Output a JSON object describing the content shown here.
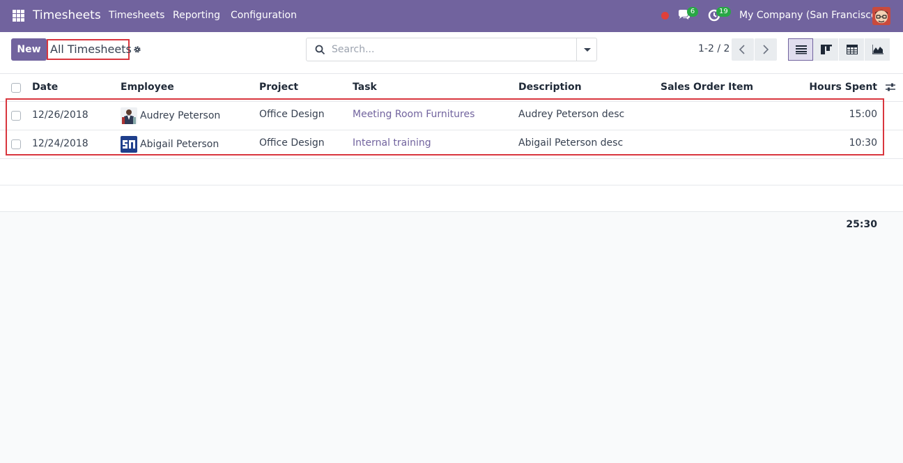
{
  "navbar": {
    "brand": "Timesheets",
    "menu": [
      "Timesheets",
      "Reporting",
      "Configuration"
    ],
    "messages_badge": "6",
    "activities_badge": "19",
    "company": "My Company (San Francisco)"
  },
  "control": {
    "new_label": "New",
    "title": "All Timesheets",
    "search_placeholder": "Search...",
    "pager": "1-2 / 2"
  },
  "table": {
    "headers": {
      "date": "Date",
      "employee": "Employee",
      "project": "Project",
      "task": "Task",
      "description": "Description",
      "sales_order_item": "Sales Order Item",
      "hours_spent": "Hours Spent"
    },
    "rows": [
      {
        "date": "12/26/2018",
        "employee": "Audrey Peterson",
        "project": "Office Design",
        "task": "Meeting Room Furnitures",
        "description": "Audrey Peterson desc",
        "sales_order_item": "",
        "hours": "15:00"
      },
      {
        "date": "12/24/2018",
        "employee": "Abigail Peterson",
        "project": "Office Design",
        "task": "Internal training",
        "description": "Abigail Peterson desc",
        "sales_order_item": "",
        "hours": "10:30"
      }
    ],
    "total_hours": "25:30"
  },
  "colors": {
    "brand": "#71639e",
    "highlight": "#d9363e",
    "badge": "#28a745"
  }
}
